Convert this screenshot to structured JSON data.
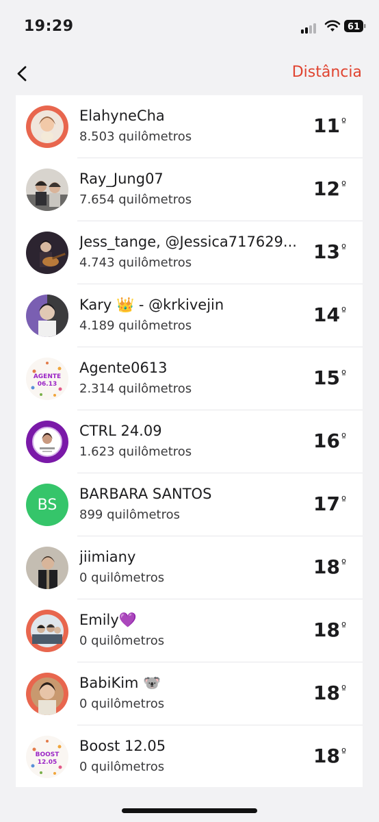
{
  "status_bar": {
    "time": "19:29",
    "battery": "61",
    "icons": [
      "signal-icon",
      "wifi-icon",
      "battery-icon"
    ]
  },
  "nav": {
    "back_icon": "chevron-left-icon",
    "action_label": "Distância",
    "accent_color": "#e0432f"
  },
  "rank_suffix": "º",
  "rows": [
    {
      "name": "ElahyneCha",
      "distance": "8.503 quilômetros",
      "rank": "11",
      "avatar": "photo"
    },
    {
      "name": "Ray_Jung07",
      "distance": "7.654 quilômetros",
      "rank": "12",
      "avatar": "photo"
    },
    {
      "name": "Jess_tange, @Jessica717629...",
      "distance": "4.743 quilômetros",
      "rank": "13",
      "avatar": "photo"
    },
    {
      "name": "Kary 👑 - @krkivejin",
      "distance": "4.189 quilômetros",
      "rank": "14",
      "avatar": "photo"
    },
    {
      "name": "Agente0613",
      "distance": "2.314 quilômetros",
      "rank": "15",
      "avatar": "badge",
      "avatar_text": [
        "AGENTE",
        "06.13"
      ]
    },
    {
      "name": "CTRL 24.09",
      "distance": "1.623 quilômetros",
      "rank": "16",
      "avatar": "photo"
    },
    {
      "name": "BARBARA SANTOS",
      "distance": "899 quilômetros",
      "rank": "17",
      "avatar": "initials",
      "avatar_text": "BS"
    },
    {
      "name": "jiimiany",
      "distance": "0 quilômetros",
      "rank": "18",
      "avatar": "photo"
    },
    {
      "name": "Emily💜",
      "distance": "0 quilômetros",
      "rank": "18",
      "avatar": "photo"
    },
    {
      "name": "BabiKim 🐨",
      "distance": "0 quilômetros",
      "rank": "18",
      "avatar": "photo"
    },
    {
      "name": "Boost 12.05",
      "distance": "0 quilômetros",
      "rank": "18",
      "avatar": "badge",
      "avatar_text": [
        "BOOST",
        "12.05"
      ]
    }
  ]
}
